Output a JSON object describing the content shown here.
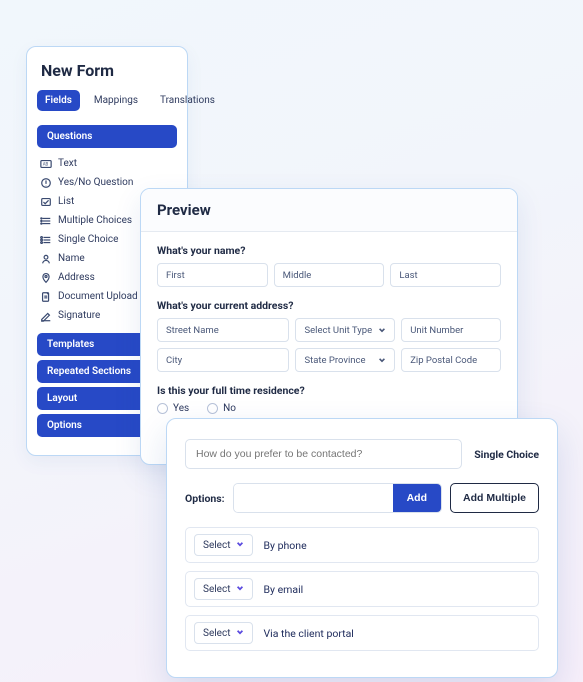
{
  "builder": {
    "title": "New Form",
    "tabs": [
      "Fields",
      "Mappings",
      "Translations"
    ],
    "active_tab": 0,
    "sections": {
      "questions": "Questions",
      "templates": "Templates",
      "repeated": "Repeated Sections",
      "layout": "Layout",
      "options": "Options"
    },
    "question_types": [
      {
        "icon": "text-icon",
        "label": "Text"
      },
      {
        "icon": "yesno-icon",
        "label": "Yes/No Question"
      },
      {
        "icon": "list-icon",
        "label": "List"
      },
      {
        "icon": "multichoice-icon",
        "label": "Multiple Choices"
      },
      {
        "icon": "singlechoice-icon",
        "label": "Single Choice"
      },
      {
        "icon": "name-icon",
        "label": "Name"
      },
      {
        "icon": "address-icon",
        "label": "Address"
      },
      {
        "icon": "upload-icon",
        "label": "Document Upload"
      },
      {
        "icon": "signature-icon",
        "label": "Signature"
      }
    ]
  },
  "preview": {
    "title": "Preview",
    "q1": {
      "label": "What's your name?",
      "placeholders": [
        "First",
        "Middle",
        "Last"
      ]
    },
    "q2": {
      "label": "What's your current address?",
      "row1": {
        "street": "Street Name",
        "unit_type": "Select Unit Type",
        "unit_number": "Unit Number"
      },
      "row2": {
        "city": "City",
        "state": "State Province",
        "zip": "Zip Postal Code"
      }
    },
    "q3": {
      "label": "Is this your full time residence?",
      "options": [
        "Yes",
        "No"
      ]
    }
  },
  "config": {
    "question_placeholder": "How do you prefer to be contacted?",
    "type_label": "Single Choice",
    "options_label": "Options:",
    "add_label": "Add",
    "add_multiple_label": "Add Multiple",
    "select_label": "Select",
    "options": [
      "By phone",
      "By email",
      "Via the client portal"
    ]
  }
}
